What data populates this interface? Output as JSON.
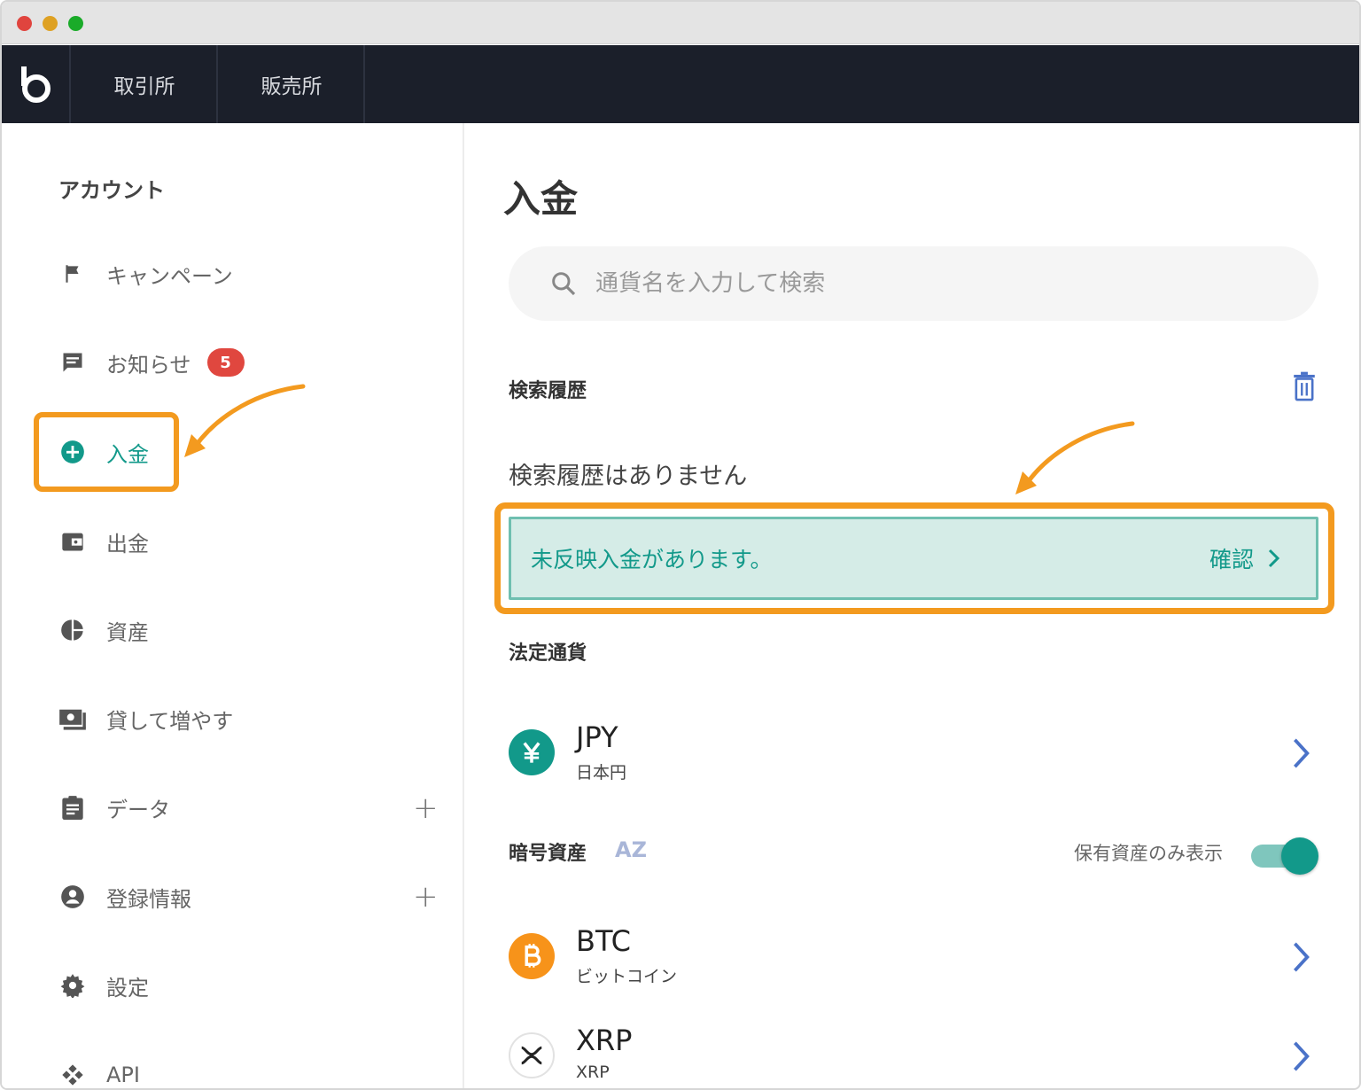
{
  "topnav": {
    "tabs": [
      {
        "label": "取引所"
      },
      {
        "label": "販売所"
      }
    ]
  },
  "sidebar": {
    "heading": "アカウント",
    "items": [
      {
        "label": "キャンペーン",
        "icon": "flag-icon"
      },
      {
        "label": "お知らせ",
        "icon": "message-icon",
        "badge": "5"
      },
      {
        "label": "入金",
        "icon": "plus-circle-icon",
        "active": true
      },
      {
        "label": "出金",
        "icon": "wallet-icon"
      },
      {
        "label": "資産",
        "icon": "pie-chart-icon"
      },
      {
        "label": "貸して増やす",
        "icon": "lend-icon"
      },
      {
        "label": "データ",
        "icon": "clipboard-icon",
        "expandable": true
      },
      {
        "label": "登録情報",
        "icon": "account-icon",
        "expandable": true
      },
      {
        "label": "設定",
        "icon": "gear-icon"
      },
      {
        "label": "API",
        "icon": "api-icon"
      }
    ]
  },
  "main": {
    "title": "入金",
    "search": {
      "placeholder": "通貨名を入力して検索"
    },
    "history": {
      "label": "検索履歴",
      "empty_text": "検索履歴はありません"
    },
    "notice": {
      "text": "未反映入金があります。",
      "action": "確認"
    },
    "fiat": {
      "label": "法定通貨",
      "items": [
        {
          "code": "JPY",
          "name": "日本円",
          "icon": "yen-icon",
          "color": "#12998a"
        }
      ]
    },
    "crypto": {
      "label": "暗号資産",
      "sort_label": "AZ",
      "toggle_label": "保有資産のみ表示",
      "toggle_on": true,
      "items": [
        {
          "code": "BTC",
          "name": "ビットコイン",
          "icon": "bitcoin-icon",
          "color": "#f7931a"
        },
        {
          "code": "XRP",
          "name": "XRP",
          "icon": "xrp-icon",
          "color": "#ffffff"
        }
      ]
    }
  },
  "colors": {
    "accent": "#12998a",
    "highlight": "#f39a1f",
    "badge": "#e0473f",
    "nav_bg": "#1b1f2a"
  }
}
